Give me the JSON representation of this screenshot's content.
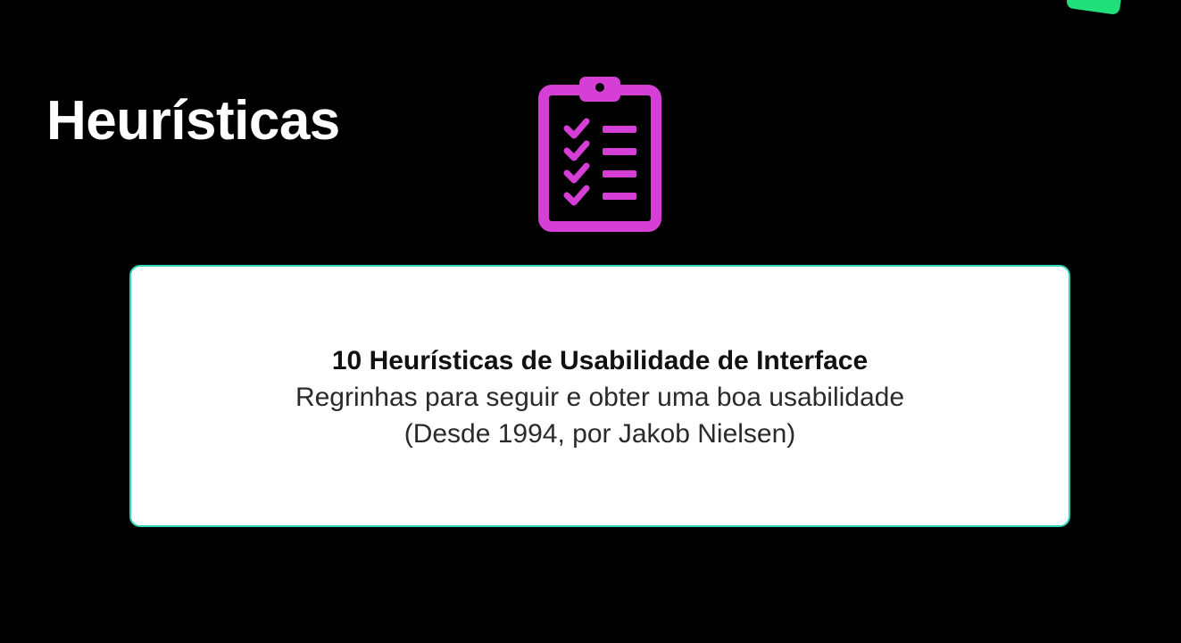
{
  "slide": {
    "title": "Heurísticas",
    "background_color": "#000000",
    "accent_color": "#1fe07a"
  },
  "icon": {
    "name": "clipboard-checklist-icon",
    "color": "#d63fd6"
  },
  "card": {
    "heading": "10 Heurísticas de Usabilidade de Interface",
    "line1": "Regrinhas para seguir e obter uma boa usabilidade",
    "line2": "(Desde 1994, por Jakob Nielsen)",
    "border_color": "#2fd4b8"
  }
}
